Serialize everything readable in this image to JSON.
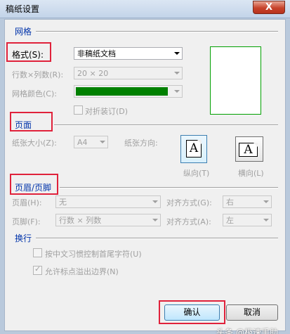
{
  "window": {
    "title": "稿纸设置",
    "close_label": "X"
  },
  "grid_section": {
    "title": "网格",
    "format_label": "格式(S):",
    "format_value": "非稿纸文档",
    "rows_cols_label": "行数×列数(R):",
    "rows_cols_value": "20 × 20",
    "grid_color_label": "网格颜色(C):",
    "grid_color_value": "#008000",
    "fold_binding_label": "对折装订(D)"
  },
  "page_section": {
    "title": "页面",
    "paper_size_label": "纸张大小(Z):",
    "paper_size_value": "A4",
    "orientation_label": "纸张方向:",
    "portrait_label": "纵向(T)",
    "landscape_label": "横向(L)",
    "orientation_glyph": "A"
  },
  "header_footer_section": {
    "title": "页眉/页脚",
    "header_label": "页眉(H):",
    "header_value": "无",
    "header_align_label": "对齐方式(G):",
    "header_align_value": "右",
    "footer_label": "页脚(F):",
    "footer_value": "行数 × 列数",
    "footer_align_label": "对齐方式(A):",
    "footer_align_value": "左"
  },
  "line_break_section": {
    "title": "换行",
    "option1_label": "按中文习惯控制首尾字符(U)",
    "option1_checked": false,
    "option2_label": "允许标点溢出边界(N)",
    "option2_checked": true
  },
  "buttons": {
    "ok_label": "确认",
    "cancel_label": "取消"
  },
  "watermark": "头条 @极速手助",
  "colors": {
    "highlight_box": "#e0223b",
    "section_title": "#0033aa",
    "grid_color": "#008000"
  }
}
